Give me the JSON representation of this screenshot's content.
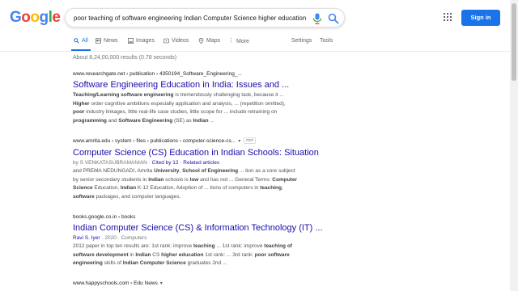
{
  "header": {
    "logo_letters": [
      {
        "ch": "G",
        "color": "#4285f4"
      },
      {
        "ch": "o",
        "color": "#ea4335"
      },
      {
        "ch": "o",
        "color": "#fbbc05"
      },
      {
        "ch": "g",
        "color": "#4285f4"
      },
      {
        "ch": "l",
        "color": "#34a853"
      },
      {
        "ch": "e",
        "color": "#ea4335"
      }
    ],
    "query": "poor teaching of software engineering Indian Computer Science higher education",
    "signin_label": "Sign in",
    "accent_color": "#1a73e8"
  },
  "tabs": {
    "all": "All",
    "news": "News",
    "images": "Images",
    "videos": "Videos",
    "maps": "Maps",
    "more": "More",
    "settings": "Settings",
    "tools": "Tools"
  },
  "stats": "About 8,24,00,000 results (0.78 seconds)",
  "results": [
    {
      "cite": "www.researchgate.net › publication › 4350194_Software_Engineering_...",
      "title": "Software Engineering Education in India: Issues and ...",
      "snippet_html": "<b>Teaching/Learning software engineering</b> is tremendously challenging task, because it ...<br><b>Higher</b> order cognitive ambitions especially application and analysis, ... (repetition omitted),<br><b>poor</b> industry linkages, little real-life case studies, little scope for ... include retraining on<br><b>programming</b> and <b>Software Engineering</b> (SE) as <b>Indian</b> ..."
    },
    {
      "cite": "www.amrita.edu › system › files › publications › computer-science-cs...",
      "pdf": "PDF",
      "title": "Computer Science (CS) Education in Indian Schools: Situation",
      "byline_prefix": "by S VENKATASUBRAMANIAN · ",
      "byline_link": "Cited by 12 · Related articles",
      "snippet_html": "and PREMA NEDUNGADI, Amrita <b>University</b>, <b>School of Engineering</b> ... tion as a core subject<br>by senior secondary students in <b>Indian</b> schools is <b>low</b> and has not ... General Terms: <b>Computer</b><br><b>Science</b> Education, <b>Indian</b> K-12 Education, Adoption of ... tions of computers in <b>teaching</b>,<br><b>software</b> packages, and computer languages."
    },
    {
      "cite": "books.google.co.in › books",
      "title": "Indian Computer Science (CS) & Information Technology (IT) ...",
      "byline_link": "Ravi S. Iyer",
      "byline_suffix": " · 2020 · Computers",
      "snippet_html": "2012 paper in top ten results are: 1st rank: improve <b>teaching</b> ... 1st rank: improve <b>teaching of</b><br><b>software development</b> in <b>Indian</b> CS <b>higher education</b> 1st rank: ... 3rd rank: <b>poor software</b><br><b>engineering</b> skills of <b>Indian Computer Science</b> graduates 2nd ..."
    },
    {
      "cite": "www.happyschools.com › Edu News"
    }
  ]
}
